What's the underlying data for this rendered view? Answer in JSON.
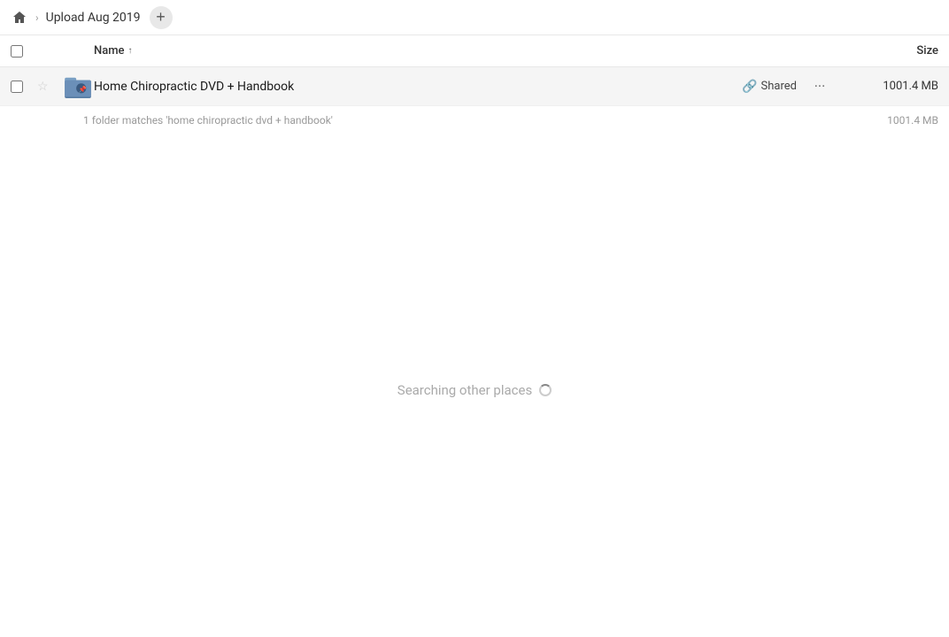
{
  "topbar": {
    "home_icon": "🏠",
    "breadcrumb_title": "Upload Aug 2019",
    "add_button_label": "+"
  },
  "columns": {
    "name_label": "Name",
    "sort_arrow": "↑",
    "size_label": "Size"
  },
  "file_row": {
    "name": "Home Chiropractic DVD + Handbook",
    "shared_label": "Shared",
    "size": "1001.4 MB",
    "more_icon": "···"
  },
  "match_info": {
    "text": "1 folder matches 'home chiropractic dvd + handbook'",
    "size": "1001.4 MB"
  },
  "searching": {
    "text": "Searching other places"
  }
}
